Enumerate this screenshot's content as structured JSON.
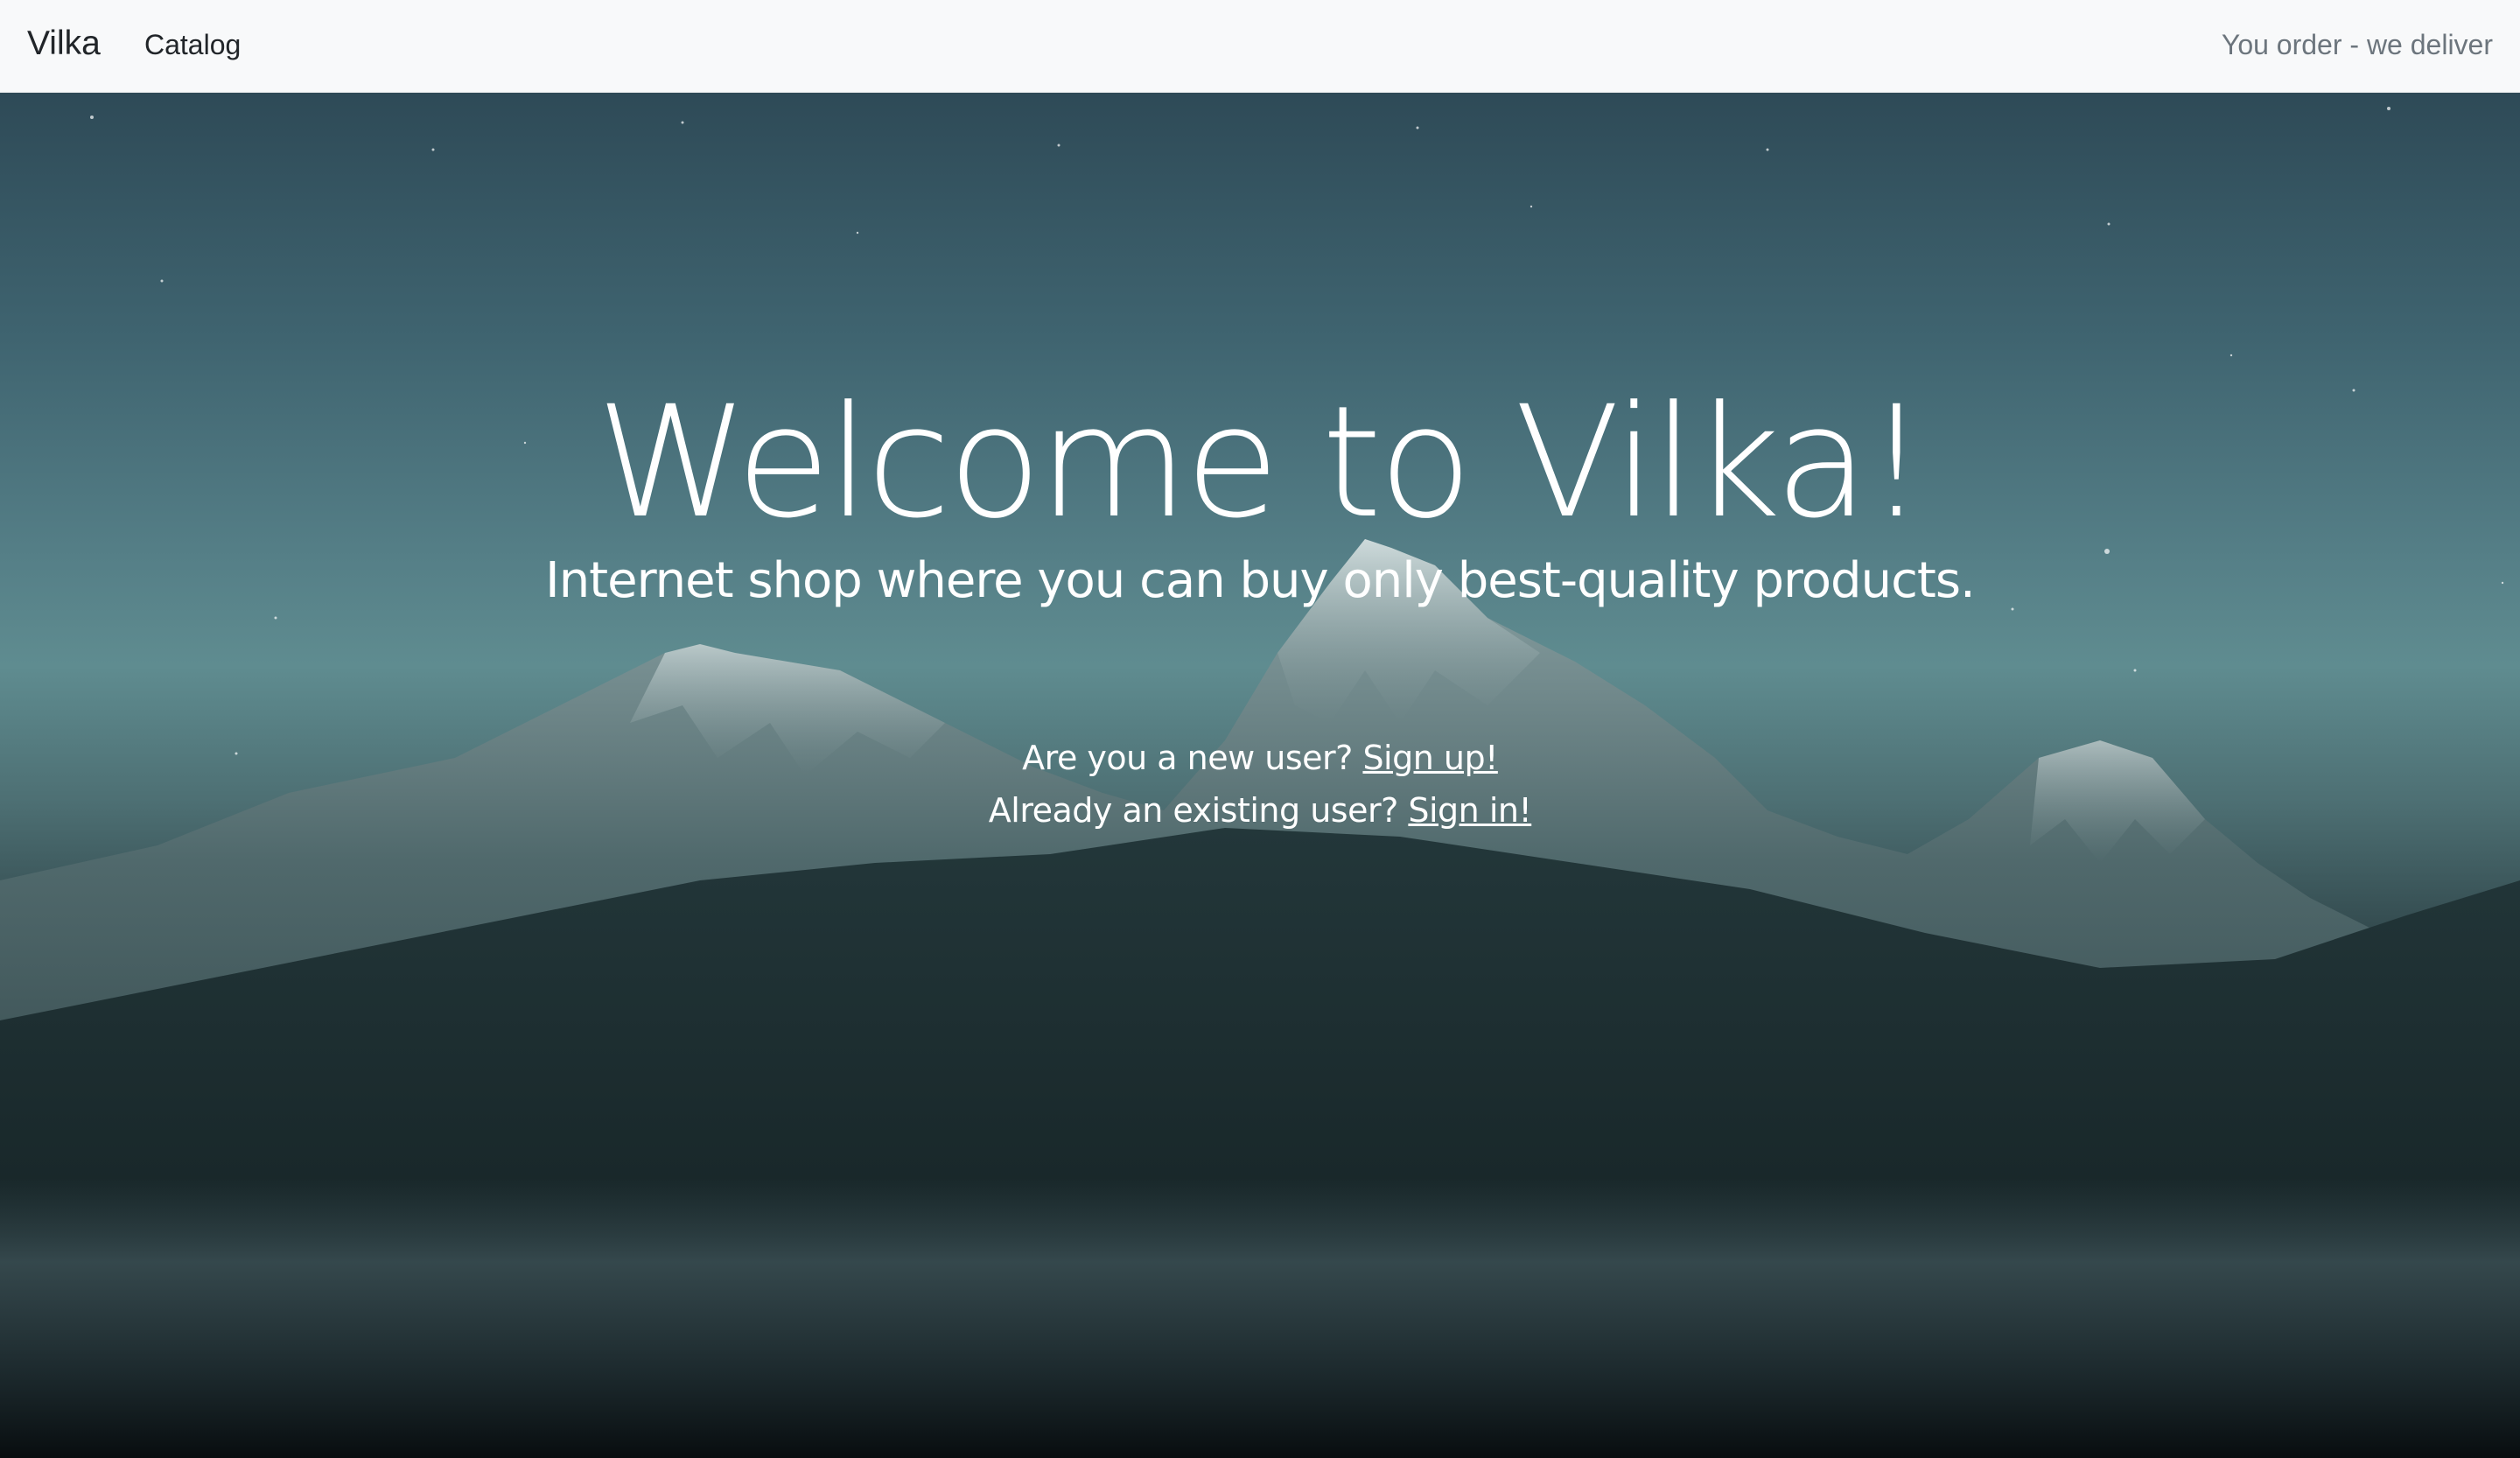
{
  "navbar": {
    "brand": "Vilka",
    "links": [
      {
        "label": "Catalog"
      }
    ],
    "tagline": "You order - we deliver"
  },
  "hero": {
    "title": "Welcome to Vilka!",
    "subtitle": "Internet shop where you can buy only best-quality products.",
    "signup_prompt": "Are you a new user?",
    "signup_link": "Sign up!",
    "signin_prompt": "Already an existing user?",
    "signin_link": "Sign in!"
  },
  "colors": {
    "navbar_bg": "#f8f9fa",
    "text_dark": "#212529",
    "text_muted": "#6c757d",
    "hero_text": "#ffffff"
  }
}
